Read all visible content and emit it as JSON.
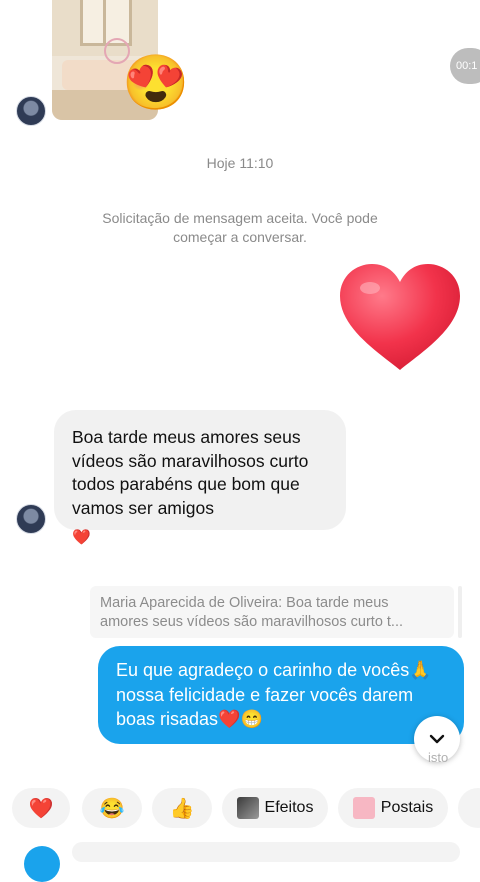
{
  "top": {
    "media_icon": "image-thumbnail",
    "reaction_emoji": "😍",
    "timer_text": "00:1"
  },
  "date_divider": "Hoje 11:10",
  "system_notice": {
    "line1": "Solicitação de mensagem aceita. Você pode",
    "line2": "começar a conversar."
  },
  "sent_heart": "heart-icon",
  "incoming": {
    "line1": "Boa tarde meus amores seus",
    "line2": "vídeos são maravilhosos curto",
    "line3": "todos parabéns que bom que",
    "line4": "vamos ser amigos",
    "reaction": "❤️"
  },
  "reply_quote": {
    "line1": "Maria Aparecida de Oliveira: Boa tarde meus",
    "line2": "amores seus vídeos são maravilhosos curto t..."
  },
  "outgoing": {
    "line1": "Eu que agradeço o carinho de vocês🙏",
    "line2": "nossa felicidade e fazer vocês darem",
    "line3": "boas risadas❤️😁"
  },
  "seen_status": "isto",
  "quick_actions": [
    {
      "emoji": "❤️"
    },
    {
      "emoji": "😂"
    },
    {
      "emoji": "👍"
    },
    {
      "label": "Efeitos"
    },
    {
      "label": "Postais"
    }
  ],
  "colors": {
    "outgoing_bubble": "#1aa3ec",
    "incoming_bubble": "#f1f1f1",
    "heart": "#f2334b"
  }
}
